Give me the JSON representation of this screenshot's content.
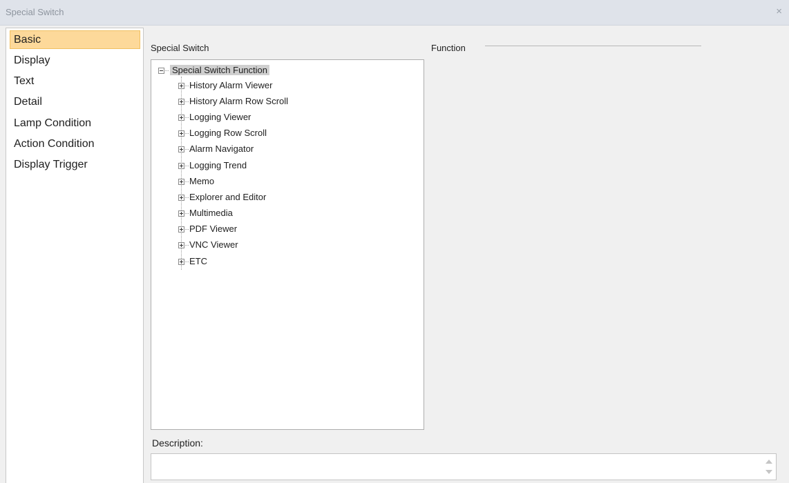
{
  "window": {
    "title": "Special Switch",
    "close": "×"
  },
  "sidebar": {
    "items": [
      {
        "label": "Basic",
        "selected": true
      },
      {
        "label": "Display"
      },
      {
        "label": "Text"
      },
      {
        "label": "Detail"
      },
      {
        "label": "Lamp Condition"
      },
      {
        "label": "Action Condition"
      },
      {
        "label": "Display Trigger"
      }
    ]
  },
  "main": {
    "special_switch_label": "Special Switch",
    "function_label": "Function",
    "tree": {
      "root": "Special Switch Function",
      "items": [
        "History Alarm Viewer",
        "History Alarm Row Scroll",
        "Logging Viewer",
        "Logging Row Scroll",
        "Alarm Navigator",
        "Logging Trend",
        "Memo",
        "Explorer and Editor",
        "Multimedia",
        "PDF Viewer",
        "VNC Viewer",
        "ETC"
      ]
    },
    "description_label": "Description:",
    "description_value": ""
  },
  "colors": {
    "selected_bg": "#fdd99a",
    "titlebar_bg": "#dfe3ea",
    "root_highlight": "#cfcfcf"
  }
}
